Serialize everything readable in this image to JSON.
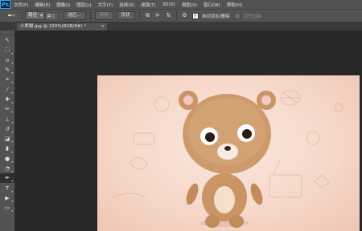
{
  "app": {
    "logo": "Ps"
  },
  "menu": [
    "文件(F)",
    "编辑(E)",
    "图像(I)",
    "图层(L)",
    "文字(Y)",
    "选择(S)",
    "滤镜(T)",
    "3D(D)",
    "视图(V)",
    "窗口(W)",
    "帮助(H)"
  ],
  "options": {
    "tool_icon": "pen-icon",
    "mode_select": "路径",
    "make_label": "建立：",
    "selection_button": "选区...",
    "mask_button": "蒙版",
    "shape_button": "形状",
    "auto_add_delete_checked": true,
    "auto_add_delete_label": "自动添加/删除",
    "align_edges_checked": false,
    "align_edges_label": "对齐边缘"
  },
  "document": {
    "tab_title": "小熊猫.jpg @ 100%(RGB/8#) *",
    "close_glyph": "×"
  },
  "tools": [
    {
      "name": "move-tool",
      "glyph": "↖"
    },
    {
      "name": "marquee-tool",
      "glyph": "⬚"
    },
    {
      "name": "lasso-tool",
      "glyph": "ⴰ"
    },
    {
      "name": "quick-select-tool",
      "glyph": "✎"
    },
    {
      "name": "crop-tool",
      "glyph": "⌗"
    },
    {
      "name": "eyedropper-tool",
      "glyph": "⁄"
    },
    {
      "name": "healing-brush-tool",
      "glyph": "✚"
    },
    {
      "name": "brush-tool",
      "glyph": "✏"
    },
    {
      "name": "clone-stamp-tool",
      "glyph": "⊥"
    },
    {
      "name": "history-brush-tool",
      "glyph": "↺"
    },
    {
      "name": "eraser-tool",
      "glyph": "◪"
    },
    {
      "name": "gradient-tool",
      "glyph": "▮"
    },
    {
      "name": "blur-tool",
      "glyph": "●"
    },
    {
      "name": "dodge-tool",
      "glyph": "◔"
    },
    {
      "name": "pen-tool",
      "glyph": "✒",
      "active": true
    },
    {
      "name": "type-tool",
      "glyph": "T"
    },
    {
      "name": "path-select-tool",
      "glyph": "▶"
    },
    {
      "name": "shape-tool",
      "glyph": "▭"
    }
  ],
  "colors": {
    "panel": "#535353",
    "workspace": "#282828",
    "accent": "#31a8ff"
  }
}
